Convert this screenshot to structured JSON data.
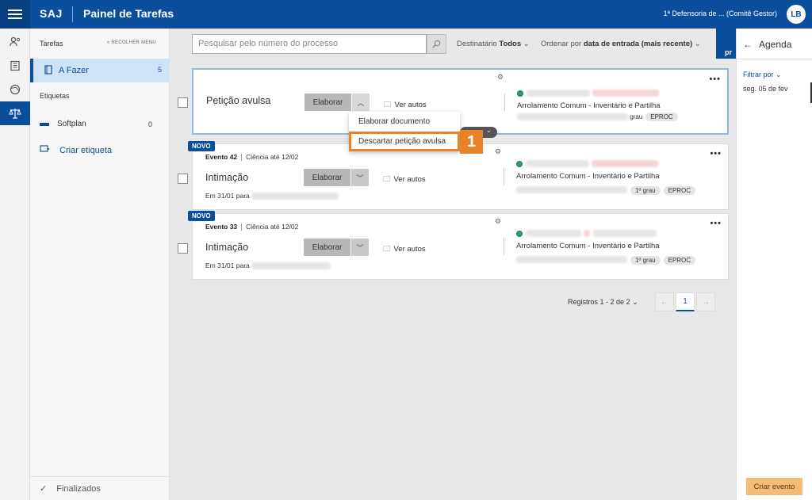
{
  "header": {
    "brand": "SAJ",
    "title": "Painel de Tarefas",
    "org": "1ª Defensoria de ... (Comitê Gestor)",
    "user_initials": "LB"
  },
  "rail": {
    "icons": [
      "person-settings-icon",
      "book-icon",
      "globe-icon",
      "scale-icon"
    ]
  },
  "sidebar": {
    "tasks_header": "Tarefas",
    "collapse_label": "« RECOLHER MENU",
    "todo": {
      "label": "A Fazer",
      "count": "5"
    },
    "labels_header": "Etiquetas",
    "tag": {
      "label": "Softplan",
      "count": "0"
    },
    "create_tag": "Criar etiqueta",
    "finished": "Finalizados"
  },
  "toolbar": {
    "search_placeholder": "Pesquisar pelo número do processo",
    "recipient_label": "Destinatário",
    "recipient_value": "Todos",
    "order_label": "Ordenar por",
    "order_value": "data de entrada (mais recente)",
    "side_tab_label": "pr"
  },
  "agenda": {
    "title": "Agenda",
    "filter_label": "Filtrar por",
    "date": "seg. 05 de fev",
    "create_button": "Criar evento"
  },
  "cards": [
    {
      "title": "Petição avulsa",
      "elaborate": "Elaborar",
      "view": "Ver autos",
      "process_class": "Arrolamento Comum - Inventário e Partilha",
      "degree": "grau",
      "system": "EPROC"
    },
    {
      "novo": "NOVO",
      "event": "Evento 42",
      "deadline": "Ciência até 12/02",
      "title": "Intimação",
      "sub_prefix": "Em 31/01 para",
      "elaborate": "Elaborar",
      "view": "Ver autos",
      "process_class": "Arrolamento Comum - Inventário e Partilha",
      "degree": "1º grau",
      "system": "EPROC"
    },
    {
      "novo": "NOVO",
      "event": "Evento 33",
      "deadline": "Ciência até 12/02",
      "title": "Intimação",
      "sub_prefix": "Em 31/01 para",
      "elaborate": "Elaborar",
      "view": "Ver autos",
      "process_class": "Arrolamento Comum - Inventário e Partilha",
      "degree": "1º grau",
      "system": "EPROC"
    }
  ],
  "dropdown": {
    "items": [
      "Elaborar documento",
      "Descartar petição avulsa"
    ],
    "highlighted": "Descartar petição avulsa",
    "step": "1"
  },
  "pagination": {
    "label": "Registros 1 - 2 de 2",
    "current_page": "1"
  },
  "colors": {
    "primary": "#0b4f9c",
    "highlight": "#e8832a",
    "create_event": "#f6bb78",
    "status_green": "#2e9f6a"
  }
}
